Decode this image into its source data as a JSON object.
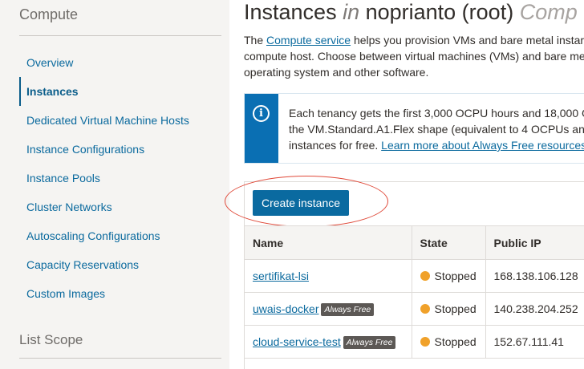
{
  "sidebar": {
    "title": "Compute",
    "items": [
      {
        "label": "Overview"
      },
      {
        "label": "Instances",
        "active": true
      },
      {
        "label": "Dedicated Virtual Machine Hosts"
      },
      {
        "label": "Instance Configurations"
      },
      {
        "label": "Instance Pools"
      },
      {
        "label": "Cluster Networks"
      },
      {
        "label": "Autoscaling Configurations"
      },
      {
        "label": "Capacity Reservations"
      },
      {
        "label": "Custom Images"
      }
    ],
    "scope_title": "List Scope"
  },
  "header": {
    "title_prefix": "Instances ",
    "title_in": "in",
    "title_compartment": " noprianto (root) ",
    "title_suffix": "Comp"
  },
  "intro": {
    "prefix": "The ",
    "link": "Compute service",
    "line1_rest": " helps you provision VMs and bare metal instar",
    "line2": "compute host. Choose between virtual machines (VMs) and bare me",
    "line3": "operating system and other software."
  },
  "info": {
    "icon": "info-icon",
    "line1": "Each tenancy gets the first 3,000 OCPU hours and 18,000 G",
    "line2": "the VM.Standard.A1.Flex shape (equivalent to 4 OCPUs an",
    "line3_prefix": "instances for free. ",
    "line3_link": "Learn more about Always Free resources"
  },
  "toolbar": {
    "create_label": "Create instance"
  },
  "table": {
    "columns": [
      "Name",
      "State",
      "Public IP"
    ],
    "rows": [
      {
        "name": "sertifikat-lsi",
        "badge": "",
        "state": "Stopped",
        "public_ip": "168.138.106.128"
      },
      {
        "name": "uwais-docker",
        "badge": "Always Free",
        "state": "Stopped",
        "public_ip": "140.238.204.252"
      },
      {
        "name": "cloud-service-test",
        "badge": "Always Free",
        "state": "Stopped",
        "public_ip": "152.67.111.41"
      }
    ]
  },
  "colors": {
    "accent": "#0a6aa0",
    "link": "#0b6a9e",
    "stopped_status": "#f0a12a",
    "annotation_ring": "#e04a3a"
  }
}
